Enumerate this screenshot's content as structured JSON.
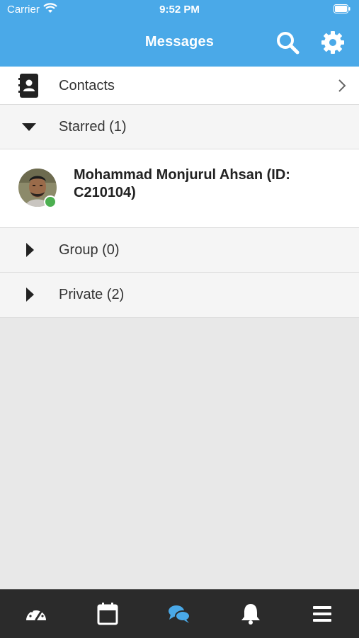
{
  "status_bar": {
    "carrier": "Carrier",
    "time": "9:52 PM"
  },
  "header": {
    "title": "Messages",
    "search_icon": "search-icon",
    "settings_icon": "gear-icon"
  },
  "contacts_row": {
    "label": "Contacts",
    "icon": "address-book-icon"
  },
  "sections": {
    "starred": {
      "label": "Starred (1)",
      "expanded": true
    },
    "group": {
      "label": "Group (0)",
      "expanded": false
    },
    "private": {
      "label": "Private (2)",
      "expanded": false
    }
  },
  "starred_items": [
    {
      "name": "Mohammad Monjurul Ahsan (ID: C210104)",
      "online": true
    }
  ],
  "tab_bar": {
    "tabs": [
      {
        "icon": "dashboard-icon",
        "active": false
      },
      {
        "icon": "calendar-icon",
        "active": false
      },
      {
        "icon": "chat-icon",
        "active": true
      },
      {
        "icon": "bell-icon",
        "active": false
      },
      {
        "icon": "menu-icon",
        "active": false
      }
    ]
  },
  "colors": {
    "header": "#4aa9e8",
    "active_tab": "#4aa9e8",
    "online": "#4caf50",
    "tab_bar": "#2b2b2b"
  }
}
